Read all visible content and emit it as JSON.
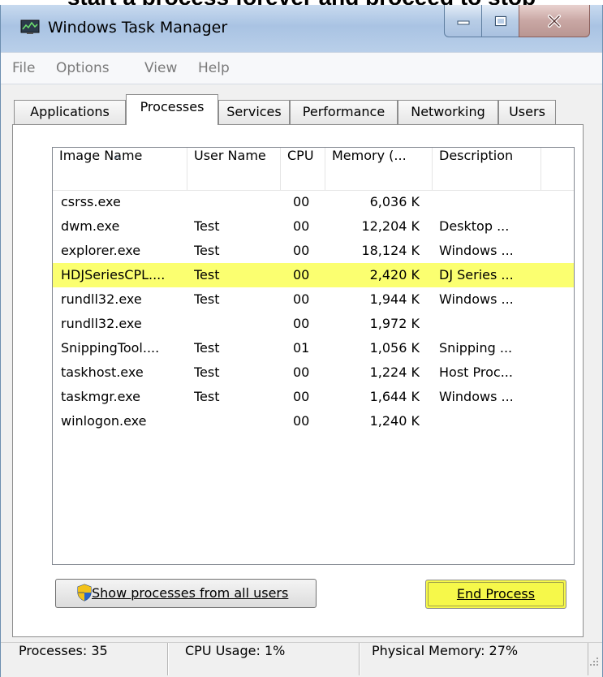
{
  "caption": {
    "text": "start a process forever and proceed to stop"
  },
  "window": {
    "title": "Windows Task Manager"
  },
  "menu": [
    "File",
    "Options",
    "View",
    "Help"
  ],
  "tabs": [
    {
      "label": "Applications",
      "active": false
    },
    {
      "label": "Processes",
      "active": true
    },
    {
      "label": "Services",
      "active": false
    },
    {
      "label": "Performance",
      "active": false
    },
    {
      "label": "Networking",
      "active": false
    },
    {
      "label": "Users",
      "active": false
    }
  ],
  "columns": [
    "Image Name",
    "User Name",
    "CPU",
    "Memory (...",
    "Description"
  ],
  "rows": [
    {
      "name": "csrss.exe",
      "user": "",
      "cpu": "00",
      "memory": "6,036 K",
      "description": "",
      "highlighted": false
    },
    {
      "name": "dwm.exe",
      "user": "Test",
      "cpu": "00",
      "memory": "12,204 K",
      "description": "Desktop ...",
      "highlighted": false
    },
    {
      "name": "explorer.exe",
      "user": "Test",
      "cpu": "00",
      "memory": "18,124 K",
      "description": "Windows ...",
      "highlighted": false
    },
    {
      "name": "HDJSeriesCPL....",
      "user": "Test",
      "cpu": "00",
      "memory": "2,420 K",
      "description": "DJ Series ...",
      "highlighted": true
    },
    {
      "name": "rundll32.exe",
      "user": "Test",
      "cpu": "00",
      "memory": "1,944 K",
      "description": "Windows ...",
      "highlighted": false
    },
    {
      "name": "rundll32.exe",
      "user": "",
      "cpu": "00",
      "memory": "1,972 K",
      "description": "",
      "highlighted": false
    },
    {
      "name": "SnippingTool....",
      "user": "Test",
      "cpu": "01",
      "memory": "1,056 K",
      "description": "Snipping ...",
      "highlighted": false
    },
    {
      "name": "taskhost.exe",
      "user": "Test",
      "cpu": "00",
      "memory": "1,224 K",
      "description": "Host Proc...",
      "highlighted": false
    },
    {
      "name": "taskmgr.exe",
      "user": "Test",
      "cpu": "00",
      "memory": "1,644 K",
      "description": "Windows ...",
      "highlighted": false
    },
    {
      "name": "winlogon.exe",
      "user": "",
      "cpu": "00",
      "memory": "1,240 K",
      "description": "",
      "highlighted": false
    }
  ],
  "buttons": {
    "show_all": "Show processes from all users",
    "end_process": "End Process"
  },
  "status": {
    "processes": "Processes: 35",
    "cpu": "CPU Usage: 1%",
    "memory": "Physical Memory: 27%"
  },
  "colors": {
    "highlight": "#fbff70",
    "titlebar": "#b9cfe9"
  },
  "icons": [
    "task-manager-icon",
    "minimize-icon",
    "maximize-icon",
    "close-icon",
    "sort-arrow-icon",
    "uac-shield-icon",
    "size-grip-icon"
  ]
}
